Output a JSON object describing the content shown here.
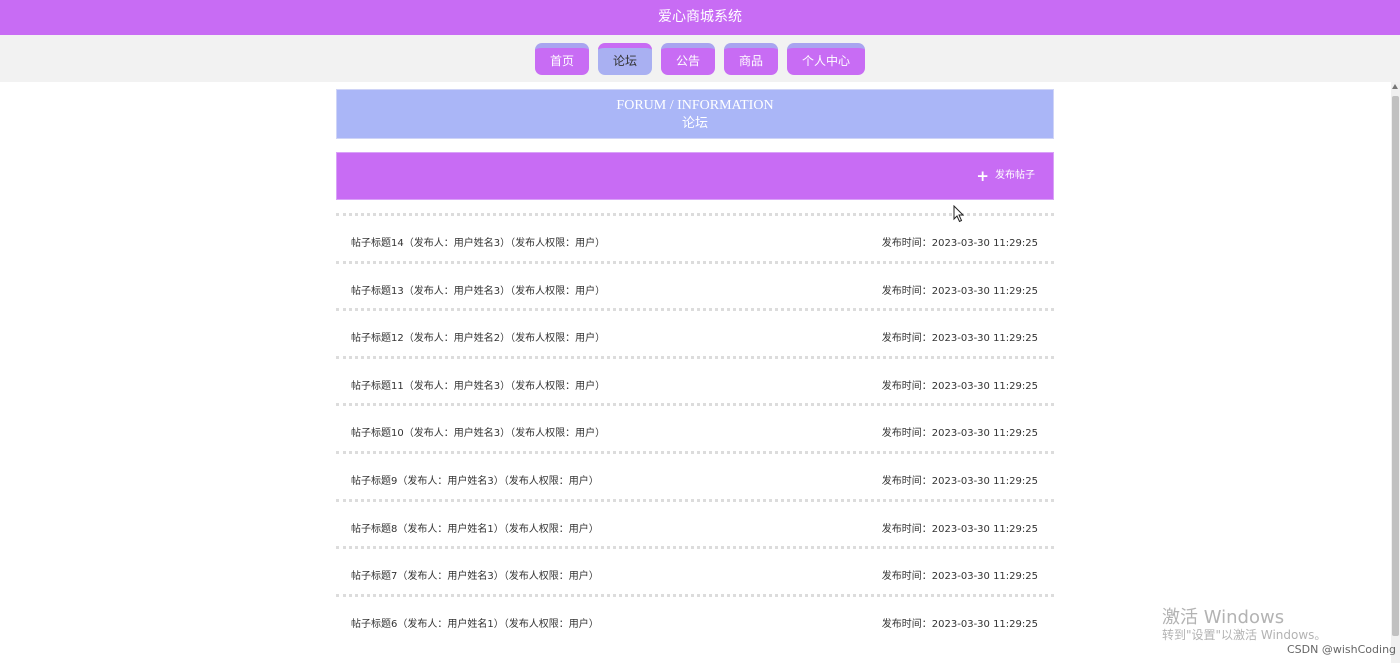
{
  "header": {
    "title": "爱心商城系统"
  },
  "nav": {
    "items": [
      {
        "label": "首页"
      },
      {
        "label": "论坛"
      },
      {
        "label": "公告"
      },
      {
        "label": "商品"
      },
      {
        "label": "个人中心"
      }
    ],
    "active": "论坛"
  },
  "banner": {
    "title_en": "FORUM / INFORMATION",
    "title_cn": "论坛"
  },
  "toolbar": {
    "publish_label": "发布帖子",
    "publish_icon": "plus-icon"
  },
  "posts": [
    {
      "title": "帖子标题14（发布人：用户姓名3）（发布人权限：用户）",
      "time": "发布时间：2023-03-30 11:29:25"
    },
    {
      "title": "帖子标题13（发布人：用户姓名3）（发布人权限：用户）",
      "time": "发布时间：2023-03-30 11:29:25"
    },
    {
      "title": "帖子标题12（发布人：用户姓名2）（发布人权限：用户）",
      "time": "发布时间：2023-03-30 11:29:25"
    },
    {
      "title": "帖子标题11（发布人：用户姓名3）（发布人权限：用户）",
      "time": "发布时间：2023-03-30 11:29:25"
    },
    {
      "title": "帖子标题10（发布人：用户姓名3）（发布人权限：用户）",
      "time": "发布时间：2023-03-30 11:29:25"
    },
    {
      "title": "帖子标题9（发布人：用户姓名3）（发布人权限：用户）",
      "time": "发布时间：2023-03-30 11:29:25"
    },
    {
      "title": "帖子标题8（发布人：用户姓名1）（发布人权限：用户）",
      "time": "发布时间：2023-03-30 11:29:25"
    },
    {
      "title": "帖子标题7（发布人：用户姓名3）（发布人权限：用户）",
      "time": "发布时间：2023-03-30 11:29:25"
    },
    {
      "title": "帖子标题6（发布人：用户姓名1）（发布人权限：用户）",
      "time": "发布时间：2023-03-30 11:29:25"
    }
  ],
  "overlay": {
    "activation_title": "激活 Windows",
    "activation_hint": "转到\"设置\"以激活 Windows。",
    "credit": "CSDN @wishCoding"
  },
  "colors": {
    "brand": "#c86cf4",
    "banner": "#aab6f7",
    "nav_active": "#a9b0f2"
  }
}
